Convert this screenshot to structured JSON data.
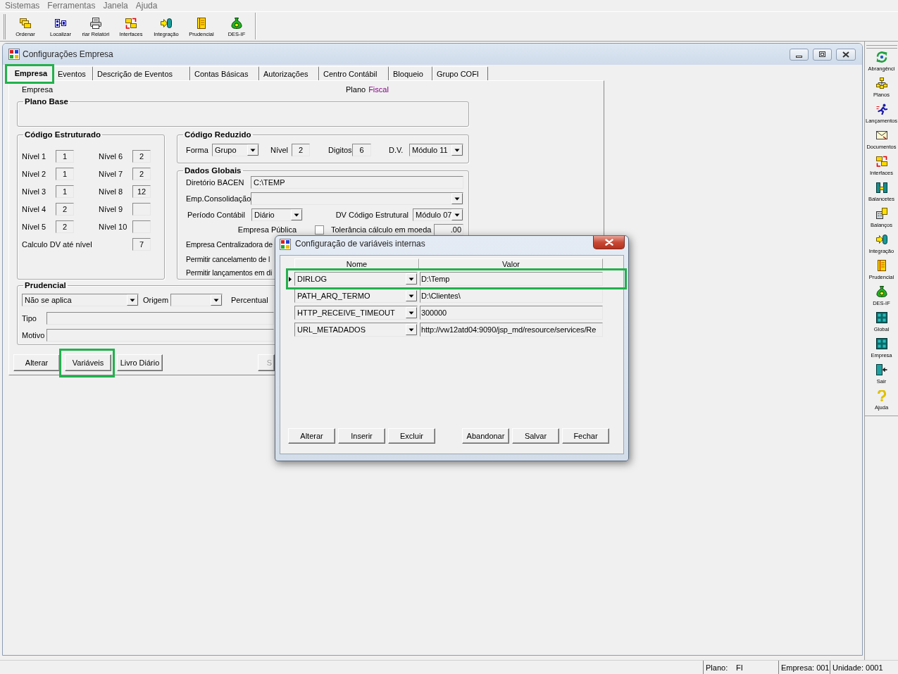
{
  "menu_bar": [
    "Sistemas",
    "Ferramentas",
    "Janela",
    "Ajuda"
  ],
  "toolbar": [
    "Ordenar",
    "Localizar",
    "riar Relatóri",
    "Interfaces",
    "Integração",
    "Prudencial",
    "DES-IF"
  ],
  "window": {
    "title": "Configurações Empresa",
    "tabs": [
      {
        "label": "Empresa",
        "selected": true,
        "highlighted": true
      },
      {
        "label": "Eventos",
        "selected": false,
        "highlighted": false
      },
      {
        "label": "Descrição de Eventos",
        "selected": false,
        "highlighted": false
      },
      {
        "label": "Contas Básicas",
        "selected": false,
        "highlighted": false
      },
      {
        "label": "Autorizações",
        "selected": false,
        "highlighted": false
      },
      {
        "label": "Centro Contábil",
        "selected": false,
        "highlighted": false
      },
      {
        "label": "Bloqueio",
        "selected": false,
        "highlighted": false
      },
      {
        "label": "Grupo COFI",
        "selected": false,
        "highlighted": false
      }
    ],
    "empresa_label": "Empresa",
    "plano": {
      "label": "Plano",
      "value": "Fiscal"
    },
    "plano_base": {
      "title": "Plano Base"
    },
    "codigo_estruturado": {
      "title": "Código Estruturado",
      "levels": [
        {
          "label": "Nível 1",
          "value": "1"
        },
        {
          "label": "Nível 2",
          "value": "1"
        },
        {
          "label": "Nível 3",
          "value": "1"
        },
        {
          "label": "Nível 4",
          "value": "2"
        },
        {
          "label": "Nível 5",
          "value": "2"
        },
        {
          "label": "Nível 6",
          "value": "2"
        },
        {
          "label": "Nível 7",
          "value": "2"
        },
        {
          "label": "Nível 8",
          "value": "12"
        },
        {
          "label": "Nível 9"
        },
        {
          "label": "Nível 10"
        }
      ],
      "calculo_dv": {
        "label": "Calculo DV até nível",
        "value": "7"
      }
    },
    "codigo_reduzido": {
      "title": "Código Reduzido",
      "forma": {
        "label": "Forma",
        "value": "Grupo"
      },
      "nivel": {
        "label": "Nível",
        "value": "2"
      },
      "digitos": {
        "label": "Digitos",
        "value": "6"
      },
      "dv": {
        "label": "D.V.",
        "value": "Módulo 11"
      }
    },
    "dados_globais": {
      "title": "Dados Globais",
      "diretorio_bacen": {
        "label": "Diretório BACEN",
        "value": "C:\\TEMP"
      },
      "emp_consolidacao": {
        "label": "Emp.Consolidação"
      },
      "periodo_contabil": {
        "label": "Período Contábil",
        "value": "Diário"
      },
      "dv_codigo_estrutural": {
        "label": "DV Código Estrutural",
        "value": "Módulo 07"
      },
      "empresa_publica": {
        "label": "Empresa Pública",
        "checked": false
      },
      "tolerancia": {
        "label": "Tolerância cálculo em moeda",
        "value": ".00"
      },
      "labels": [
        "Empresa Centralizadora de",
        "Permitir cancelamento de l",
        "Permitir lançamentos em di"
      ]
    },
    "prudencial": {
      "title": "Prudencial",
      "classificacao": "Não se aplica",
      "origem": {
        "label": "Origem"
      },
      "percentual": {
        "label": "Percentual"
      },
      "tipo": {
        "label": "Tipo"
      },
      "motivo": {
        "label": "Motivo"
      }
    },
    "buttons": [
      {
        "label": "Alterar",
        "disabled": false,
        "highlighted": false
      },
      {
        "label": "Variáveis",
        "disabled": false,
        "highlighted": true
      },
      {
        "label": "Livro Diário",
        "disabled": false,
        "highlighted": false
      },
      {
        "label": "S",
        "disabled": true,
        "highlighted": false
      }
    ]
  },
  "dialog": {
    "title": "Configuração de variáveis internas",
    "columns": [
      "Nome",
      "Valor"
    ],
    "rows": [
      {
        "name": "DIRLOG",
        "value": "D:\\Temp",
        "selected": true,
        "highlighted": true
      },
      {
        "name": "PATH_ARQ_TERMO",
        "value": "D:\\Clientes\\",
        "selected": false,
        "highlighted": false
      },
      {
        "name": "HTTP_RECEIVE_TIMEOUT",
        "value": "300000",
        "selected": false,
        "highlighted": false
      },
      {
        "name": "URL_METADADOS",
        "value": "http://vw12atd04:9090/jsp_md/resource/services/Re",
        "selected": false,
        "highlighted": false
      }
    ],
    "button_groups": [
      [
        "Alterar",
        "Inserir",
        "Excluir"
      ],
      [
        "Abandonar",
        "Salvar",
        "Fechar"
      ]
    ]
  },
  "sidebar": [
    "Abrangênci",
    "Planos",
    "Lançamentos",
    "Documentos",
    "Interfaces",
    "Balancetes",
    "Balanços",
    "Integração",
    "Prudencial",
    "DES-IF",
    "Global",
    "Empresa",
    "Sair",
    "Ajuda"
  ],
  "status_bar": {
    "plano": {
      "label": "Plano:",
      "value": "FI"
    },
    "empresa": "Empresa: 001",
    "unidade": "Unidade: 0001"
  }
}
